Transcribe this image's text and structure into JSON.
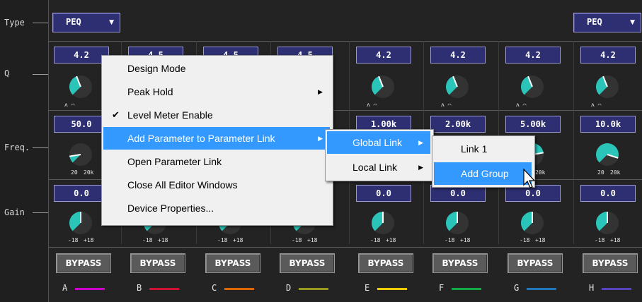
{
  "rows": {
    "type": "Type",
    "q": "Q",
    "freq": "Freq.",
    "gain": "Gain"
  },
  "type_value": "PEQ",
  "dropdown_arrow": "▼",
  "q_values": [
    "4.2",
    "4.5",
    "4.5",
    "4.5",
    "4.2",
    "4.2",
    "4.2",
    "4.2"
  ],
  "q_level": 0.42,
  "freq_values": [
    "50.0",
    "",
    "",
    "",
    "1.00k",
    "2.00k",
    "5.00k",
    "10.0k"
  ],
  "freq_tick_min": "20",
  "freq_tick_max": "20k",
  "gain_values": [
    "0.0",
    "",
    "",
    "",
    "0.0",
    "0.0",
    "0.0",
    "0.0"
  ],
  "gain_tick_min": "-18",
  "gain_tick_max": "+18",
  "bypass_label": "BYPASS",
  "channels": [
    {
      "name": "A",
      "color": "#cc00cc"
    },
    {
      "name": "B",
      "color": "#cc1133"
    },
    {
      "name": "C",
      "color": "#dd6600"
    },
    {
      "name": "D",
      "color": "#999922"
    },
    {
      "name": "E",
      "color": "#eecc00"
    },
    {
      "name": "F",
      "color": "#11aa44"
    },
    {
      "name": "G",
      "color": "#2277bb"
    },
    {
      "name": "H",
      "color": "#5544bb"
    }
  ],
  "knob_color": "#2bc4b8",
  "context_menu": {
    "items": [
      {
        "label": "Design Mode"
      },
      {
        "label": "Peak Hold"
      },
      {
        "label": "Level Meter Enable",
        "checked": true
      },
      {
        "label": "Add Parameter to Parameter Link"
      },
      {
        "label": "Open Parameter Link"
      },
      {
        "label": "Close All Editor Windows"
      },
      {
        "label": "Device Properties..."
      }
    ],
    "check_glyph": "✔",
    "submenu_arrow": "▶"
  },
  "submenu_link": {
    "items": [
      {
        "label": "Global Link"
      },
      {
        "label": "Local Link"
      }
    ]
  },
  "submenu_global": {
    "items": [
      {
        "label": "Link 1"
      },
      {
        "label": "Add Group"
      }
    ]
  }
}
